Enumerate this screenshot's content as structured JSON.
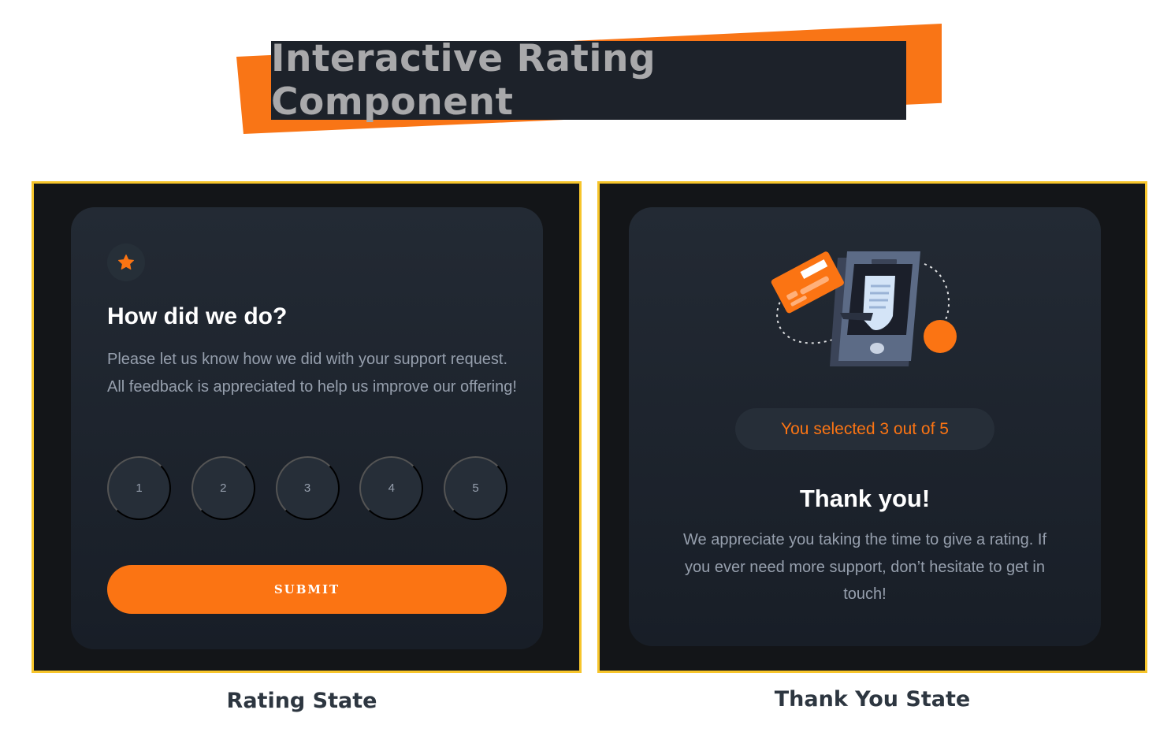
{
  "banner": {
    "title": "Interactive Rating Component"
  },
  "rating_state": {
    "icon": "star-icon",
    "title": "How did we do?",
    "description": "Please let us know how we did with your support request. All feedback is appreciated to help us improve our offering!",
    "options": [
      "1",
      "2",
      "3",
      "4",
      "5"
    ],
    "submit_label": "SUBMIT"
  },
  "thank_you_state": {
    "illustration": "payment-phone-illustration",
    "selected_text": "You selected 3 out of 5",
    "selected_value": 3,
    "max_value": 5,
    "title": "Thank you!",
    "description": "We appreciate you taking the time to give a rating. If you ever need more support, don’t hesitate to get in touch!"
  },
  "captions": {
    "left": "Rating State",
    "right": "Thank You State"
  },
  "colors": {
    "accent": "#fb7413",
    "frame_border": "#f7c52b",
    "card_bg": "#232a34",
    "page_dark": "#131518",
    "text_muted": "#969fad"
  }
}
